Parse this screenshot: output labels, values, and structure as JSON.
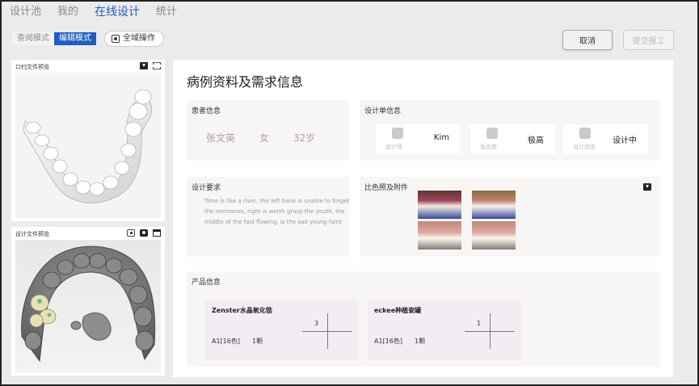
{
  "nav": {
    "items": [
      "设计池",
      "我的",
      "在线设计",
      "统计"
    ],
    "active": "在线设计"
  },
  "modes": {
    "view": "查阅模式",
    "edit": "编辑模式",
    "global_op": "全域操作"
  },
  "buttons": {
    "cancel": "取消",
    "submit": "提交报工"
  },
  "left_panels": {
    "mouth_preview_title": "口扫文件预览",
    "design_preview_title": "设计文件预览"
  },
  "main": {
    "title": "病例资料及需求信息",
    "patient": {
      "title": "患者信息",
      "name": "张文英",
      "gender": "女",
      "age": "32岁"
    },
    "design_order": {
      "title": "设计单信息",
      "stats": [
        {
          "icon": "designer-icon",
          "label": "设计师",
          "value": "Kim"
        },
        {
          "icon": "urgency-icon",
          "label": "急迫度",
          "value": "极高"
        },
        {
          "icon": "status-icon",
          "label": "设计状态",
          "value": "设计中"
        }
      ]
    },
    "requirements": {
      "title": "设计要求",
      "text": "Time is like a river, the left bank is unable to forget the memories, right is worth grasp the youth, the middle of the fast flowing, is the sad young faint"
    },
    "photos": {
      "title": "比色照及附件"
    },
    "products": {
      "title": "产品信息",
      "items": [
        {
          "name": "Zenster水晶氧化锆",
          "shade": "A1[16色]",
          "count": "1颗",
          "tooth": "3"
        },
        {
          "name": "eckee种植瓷罐",
          "shade": "A1[16色]",
          "count": "1颗",
          "tooth": "1"
        }
      ]
    }
  }
}
